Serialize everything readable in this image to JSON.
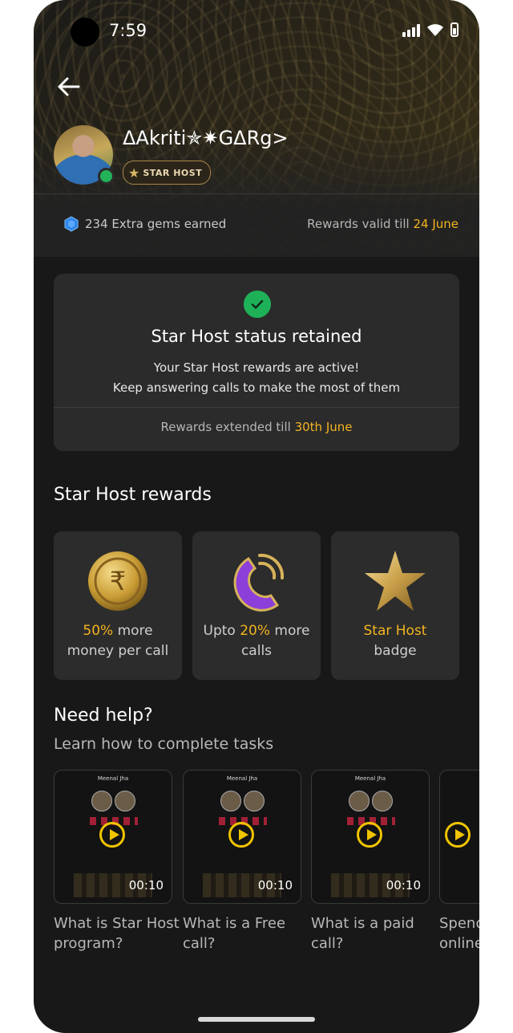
{
  "status_bar": {
    "time": "7:59"
  },
  "profile": {
    "username": "ΔAkriti✯✷GΔRg>",
    "badge": "STAR HOST",
    "gems_text": "234 Extra gems earned",
    "rewards_valid_prefix": "Rewards valid till ",
    "rewards_valid_date": "24 June"
  },
  "status_card": {
    "title": "Star Host status retained",
    "line1": "Your Star Host rewards are active!",
    "line2": "Keep answering calls to make the most of them",
    "extended_prefix": "Rewards extended till ",
    "extended_date": "30th June"
  },
  "rewards": {
    "title": "Star Host rewards",
    "items": [
      {
        "highlight": "50%",
        "text1": " more",
        "text2": "money per call",
        "icon": "rupee-coin-icon"
      },
      {
        "prefix": "Upto ",
        "highlight": "20%",
        "text1": " more",
        "text2": "calls",
        "icon": "phone-icon"
      },
      {
        "highlight": "Star Host",
        "text2": "badge",
        "icon": "star-icon"
      }
    ]
  },
  "help": {
    "title": "Need help?",
    "subtitle": "Learn how to complete tasks",
    "videos": [
      {
        "label1": "What is Star Host",
        "label2": "program?",
        "name": "Meenal Jha",
        "duration": "00:10"
      },
      {
        "label1": "What is a Free",
        "label2": "call?",
        "name": "Meenal Jha",
        "duration": "00:10"
      },
      {
        "label1": "What is a paid",
        "label2": "call?",
        "name": "Meenal Jha",
        "duration": "00:10"
      },
      {
        "label1": "Spenc",
        "label2": "online",
        "name": "",
        "duration": ""
      }
    ]
  },
  "colors": {
    "accent_gold": "#f3b420",
    "success_green": "#1fb157",
    "background": "#181818",
    "card": "#2b2b2b"
  }
}
